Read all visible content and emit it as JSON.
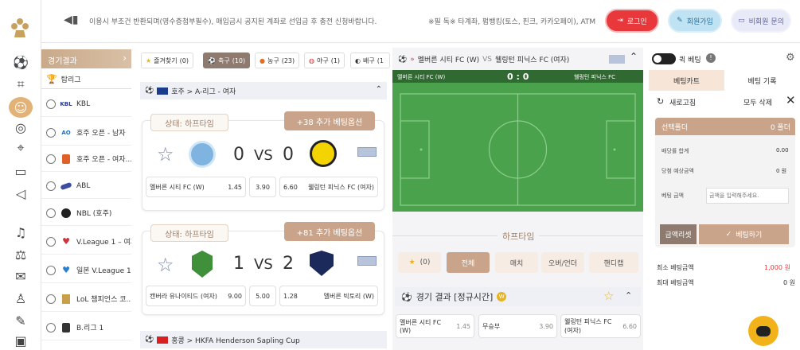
{
  "notice": "이용시 부조건 반환되며(영수증첨부필수), 매입금시 공지된 계좌로 선입금 후 충전 신청바랍니다.",
  "notice_right": "※필 독※ 타계좌, 펌뱅킹(토스, 핀크, 카카오페이), ATM",
  "buttons": {
    "login": "로그인",
    "register": "회원가입",
    "guest": "비회원 문의"
  },
  "sidebar": {
    "header": "경기결과",
    "tripple": "탑리그",
    "items": [
      {
        "logo": "KBL",
        "label": "KBL"
      },
      {
        "logo": "AO",
        "label": "호주 오픈 - 남자"
      },
      {
        "logo": "",
        "label": "호주 오픈 - 여자..."
      },
      {
        "logo": "",
        "label": "ABL"
      },
      {
        "logo": "",
        "label": "NBL (호주)"
      },
      {
        "logo": "",
        "label": "V.League 1 – 여자"
      },
      {
        "logo": "",
        "label": "일본 V.League 1..."
      },
      {
        "logo": "",
        "label": "LoL 챔피언스 코..."
      },
      {
        "logo": "",
        "label": "B.리그 1"
      }
    ]
  },
  "tabs": [
    {
      "label": "즐겨찾기",
      "count": "(0)"
    },
    {
      "label": "축구",
      "count": "(10)"
    },
    {
      "label": "농구",
      "count": "(23)"
    },
    {
      "label": "야구",
      "count": "(1)"
    },
    {
      "label": "배구",
      "count": "(1"
    }
  ],
  "league1": "호주 > A-리그 - 여자",
  "match1": {
    "status": "상태: 하프타임",
    "more": "+38 추가 베팅옵션",
    "home_score": "0",
    "vs": "VS",
    "away_score": "0",
    "home": "멜버른 시티 FC (W)",
    "home_odds": "1.45",
    "draw": "3.90",
    "away_odds": "6.60",
    "away": "웰링턴 피닉스 FC (여자)"
  },
  "match2": {
    "status": "상태: 하프타임",
    "more": "+81 추가 베팅옵션",
    "home_score": "1",
    "vs": "VS",
    "away_score": "2",
    "home": "캔버라 유나이티드 (여자)",
    "home_odds": "9.00",
    "draw": "5.00",
    "away_odds": "1.28",
    "away": "멜버른 빅토리 (W)"
  },
  "league2": "홍콩 > HKFA Henderson Sapling Cup",
  "center": {
    "title_home": "멜버른 시티 FC (W)",
    "vs": "VS",
    "title_away": "웰링턴 피닉스 FC (여자)",
    "pitch_home": "멜버른 시티 FC (W)",
    "pitch_score": "0 : 0",
    "pitch_away": "웰링턴 피닉스 FC",
    "half": "하프타임",
    "btns": [
      "(0)",
      "전체",
      "매치",
      "오버/언더",
      "핸디캡"
    ],
    "result_title": "경기 결과 [정규시간]",
    "res_home": "멜버른 시티 FC (W)",
    "res_home_odds": "1.45",
    "res_draw": "무승부",
    "res_draw_odds": "3.90",
    "res_away": "웰링턴 피닉스 FC (여자)",
    "res_away_odds": "6.60"
  },
  "slip": {
    "quick": "퀵 베팅",
    "tab_cart": "베팅카트",
    "tab_history": "베팅 기록",
    "refresh": "새로고침",
    "delete_all": "모두 삭제",
    "select": "선택폴더",
    "folder": "0 폴더",
    "odds_sum": "배당률 합계",
    "odds_sum_val": "0.00",
    "expected": "당첨 예상금액",
    "expected_val": "0 원",
    "amount": "베팅 금액",
    "placeholder": "금액을 입력해주세요.",
    "reset": "금액리셋",
    "bet": "베팅하기",
    "min": "최소 베팅금액",
    "min_val": "1,000 원",
    "max": "최대 베팅금액",
    "max_val": "0 원"
  },
  "colors": {
    "gold": "#c9a48a",
    "red": "#e8383b",
    "blue": "#2b7bd8",
    "pitch": "#4aa24c"
  }
}
